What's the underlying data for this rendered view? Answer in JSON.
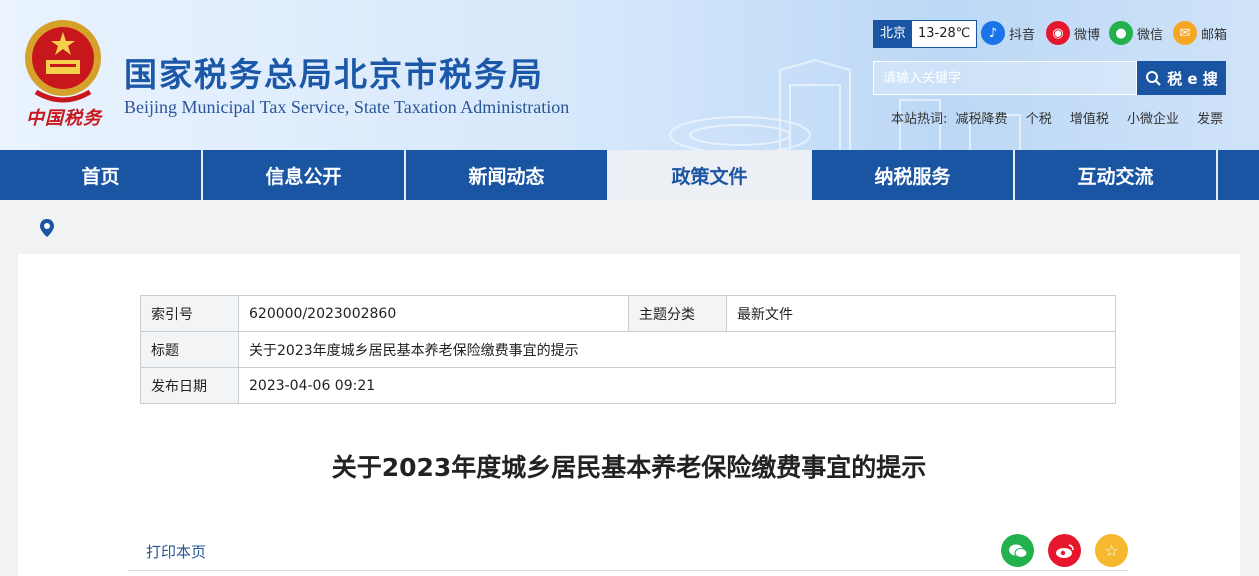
{
  "header": {
    "title": "国家税务总局北京市税务局",
    "subtitle": "Beijing Municipal Tax Service, State Taxation Administration",
    "emblem_text": "中国税务"
  },
  "weather": {
    "city": "北京",
    "temp": "13-28℃"
  },
  "social": [
    {
      "label": "抖音",
      "icon": "douyin-icon",
      "color": "#1a73e8"
    },
    {
      "label": "微博",
      "icon": "weibo-icon",
      "color": "#e6162d"
    },
    {
      "label": "微信",
      "icon": "wechat-icon",
      "color": "#22b14c"
    },
    {
      "label": "邮箱",
      "icon": "mail-icon",
      "color": "#f5a623"
    }
  ],
  "search": {
    "placeholder": "请输入关键字",
    "button": "税 e 搜"
  },
  "hot": {
    "label": "本站热词:",
    "words": [
      "减税降费",
      "个税",
      "增值税",
      "小微企业",
      "发票"
    ]
  },
  "nav": [
    "首页",
    "信息公开",
    "新闻动态",
    "政策文件",
    "纳税服务",
    "互动交流"
  ],
  "nav_active": 3,
  "meta": {
    "index_label": "索引号",
    "index_value": "620000/2023002860",
    "topic_label": "主题分类",
    "topic_value": "最新文件",
    "title_label": "标题",
    "title_value": "关于2023年度城乡居民基本养老保险缴费事宜的提示",
    "date_label": "发布日期",
    "date_value": "2023-04-06 09:21"
  },
  "article": {
    "title": "关于2023年度城乡居民基本养老保险缴费事宜的提示"
  },
  "print_label": "打印本页",
  "colors": {
    "brand": "#1a55a4",
    "share_wechat": "#22b14c",
    "share_weibo": "#e6162d",
    "share_fav": "#f5b82e"
  }
}
